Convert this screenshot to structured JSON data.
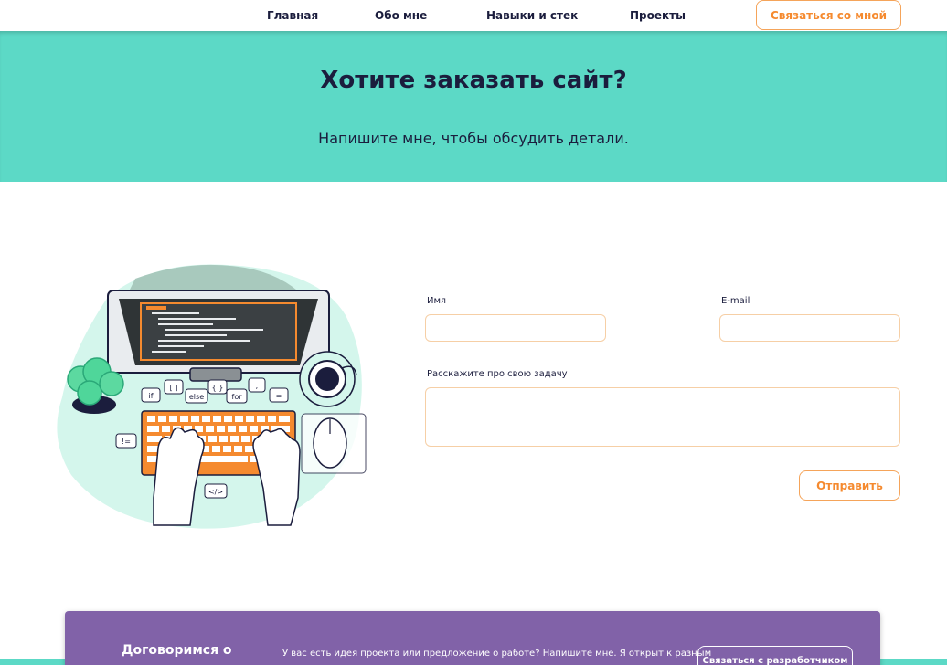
{
  "nav": {
    "items": [
      "Главная",
      "Обо мне",
      "Навыки и стек",
      "Проекты"
    ],
    "cta": "Связаться со мной"
  },
  "hero": {
    "title": "Хотите заказать сайт?",
    "subtitle": "Напишите мне, чтобы обсудить детали."
  },
  "illustration": {
    "code_tags": [
      "if",
      "[ ]",
      "else",
      "{ }",
      "for",
      ";",
      "=",
      "!=",
      "</>"
    ]
  },
  "form": {
    "name_label": "Имя",
    "name_value": "",
    "email_label": "E-mail",
    "email_value": "",
    "task_label": "Расскажите про свою задачу",
    "task_value": "",
    "submit_label": "Отправить"
  },
  "card": {
    "title": "Договоримся о",
    "text": "У вас есть идея проекта или предложение о работе? Напишите мне. Я открыт к разным",
    "button": "Связаться с разработчиком"
  },
  "colors": {
    "teal": "#5cd9c6",
    "orange": "#f58a2f",
    "navy": "#1b1d3d",
    "purple": "#8162a8"
  }
}
